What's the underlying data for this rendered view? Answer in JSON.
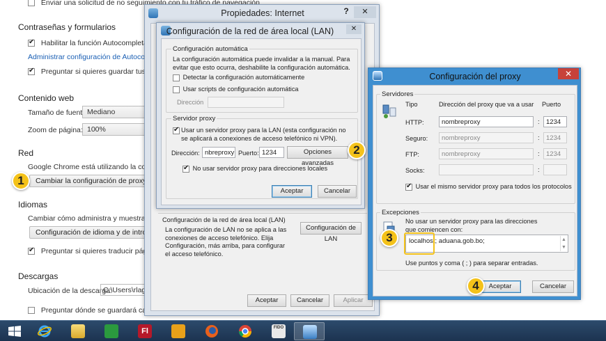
{
  "chrome": {
    "top_option": "Enviar una solicitud de no seguimiento con tu tráfico de navegación",
    "passwords_title": "Contraseñas y formularios",
    "autofill_label": "Habilitar la función Autocompletar para",
    "autofill_link": "Administrar configuración de Autocompletar",
    "save_passwords_label": "Preguntar si quieres guardar tus contra",
    "web_content_title": "Contenido web",
    "font_size_label": "Tamaño de fuente:",
    "font_size_value": "Mediano",
    "zoom_label": "Zoom de página:",
    "zoom_value": "100%",
    "network_title": "Red",
    "network_desc": "Google Chrome está utilizando la configu",
    "proxy_button": "Cambiar la configuración de proxy...",
    "languages_title": "Idiomas",
    "languages_desc": "Cambiar cómo administra y muestra Chro",
    "languages_button": "Configuración de idioma y de introduc",
    "translate_label": "Preguntar si quieres traducir páginas c",
    "downloads_title": "Descargas",
    "download_location_label": "Ubicación de la descarga:",
    "download_location_value": "C:\\Users\\rlagur",
    "ask_where_label": "Preguntar dónde se guardará cada arc"
  },
  "internet_props": {
    "title": "Propiedades: Internet",
    "help_glyph": "?",
    "close_glyph": "✕",
    "lan_section_title": "Configuración de la red de área local (LAN)",
    "lan_section_desc": "La configuración de LAN no se aplica a las conexiones de acceso telefónico. Elija Configuración, más arriba, para configurar el acceso telefónico.",
    "lan_button": "Configuración de LAN",
    "accept": "Aceptar",
    "cancel": "Cancelar",
    "apply": "Aplicar"
  },
  "lan_dialog": {
    "title": "Configuración de la red de área local (LAN)",
    "close_glyph": "✕",
    "auto_group": "Configuración automática",
    "auto_desc": "La configuración automática puede invalidar a la manual. Para evitar que esto ocurra, deshabilite la configuración automática.",
    "detect_label": "Detectar la configuración automáticamente",
    "script_label": "Usar scripts de configuración automática",
    "address_label": "Dirección",
    "proxy_group": "Servidor proxy",
    "use_proxy_label": "Usar un servidor proxy para la LAN (esta configuración no se aplicará a conexiones de acceso telefónico ni VPN).",
    "dir_label": "Dirección:",
    "dir_value": "nbreproxy",
    "port_label": "Puerto:",
    "port_value": "1234",
    "advanced_button": "Opciones avanzadas",
    "no_local_label": "No usar servidor proxy para direcciones locales",
    "accept": "Aceptar",
    "cancel": "Cancelar"
  },
  "proxy_dialog": {
    "title": "Configuración del proxy",
    "close_glyph": "✕",
    "servers_group": "Servidores",
    "col_type": "Tipo",
    "col_address": "Dirección del proxy que va a usar",
    "col_port": "Puerto",
    "rows": [
      {
        "type": "HTTP:",
        "address": "nombreproxy",
        "port": "1234",
        "enabled": true
      },
      {
        "type": "Seguro:",
        "address": "nombreproxy",
        "port": "1234",
        "enabled": false
      },
      {
        "type": "FTP:",
        "address": "nombreproxy",
        "port": "1234",
        "enabled": false
      },
      {
        "type": "Socks:",
        "address": "",
        "port": "",
        "enabled": false
      }
    ],
    "colon": ":",
    "same_server_label": "Usar el mismo servidor proxy para todos los protocolos",
    "exceptions_group": "Excepciones",
    "exceptions_desc": "No usar un servidor proxy para las direcciones que comiencen con:",
    "exceptions_prefix": "localhost;",
    "exceptions_value": "aduana.gob.bo;",
    "exceptions_hint": "Use puntos y coma ( ; ) para separar entradas.",
    "accept": "Aceptar",
    "cancel": "Cancelar"
  },
  "callouts": [
    "1",
    "2",
    "3",
    "4"
  ],
  "taskbar": {
    "items": [
      "start-icon",
      "internet-explorer-icon",
      "file-explorer-icon",
      "store-icon",
      "flash-icon",
      "outlook-icon",
      "firefox-icon",
      "chrome-icon",
      "fido-icon",
      "control-panel-icon"
    ],
    "flash_text": "Fl",
    "fido_text": "FIDO"
  },
  "colors": {
    "accent": "#3c7fb1",
    "callout": "#f4c21a",
    "taskbar": "#1c3350",
    "close": "#c7423a"
  }
}
